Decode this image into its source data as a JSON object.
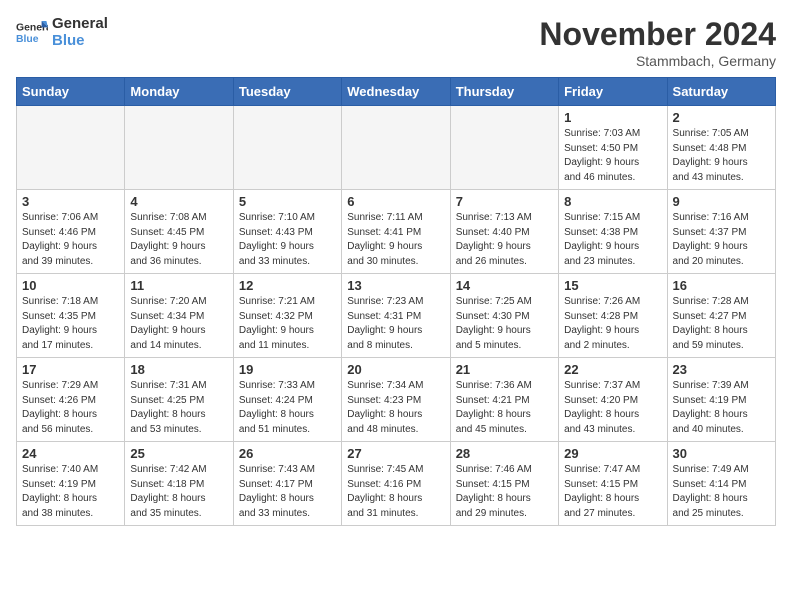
{
  "logo": {
    "line1": "General",
    "line2": "Blue"
  },
  "title": "November 2024",
  "subtitle": "Stammbach, Germany",
  "days_of_week": [
    "Sunday",
    "Monday",
    "Tuesday",
    "Wednesday",
    "Thursday",
    "Friday",
    "Saturday"
  ],
  "weeks": [
    [
      {
        "day": "",
        "info": "",
        "empty": true
      },
      {
        "day": "",
        "info": "",
        "empty": true
      },
      {
        "day": "",
        "info": "",
        "empty": true
      },
      {
        "day": "",
        "info": "",
        "empty": true
      },
      {
        "day": "",
        "info": "",
        "empty": true
      },
      {
        "day": "1",
        "info": "Sunrise: 7:03 AM\nSunset: 4:50 PM\nDaylight: 9 hours\nand 46 minutes."
      },
      {
        "day": "2",
        "info": "Sunrise: 7:05 AM\nSunset: 4:48 PM\nDaylight: 9 hours\nand 43 minutes."
      }
    ],
    [
      {
        "day": "3",
        "info": "Sunrise: 7:06 AM\nSunset: 4:46 PM\nDaylight: 9 hours\nand 39 minutes."
      },
      {
        "day": "4",
        "info": "Sunrise: 7:08 AM\nSunset: 4:45 PM\nDaylight: 9 hours\nand 36 minutes."
      },
      {
        "day": "5",
        "info": "Sunrise: 7:10 AM\nSunset: 4:43 PM\nDaylight: 9 hours\nand 33 minutes."
      },
      {
        "day": "6",
        "info": "Sunrise: 7:11 AM\nSunset: 4:41 PM\nDaylight: 9 hours\nand 30 minutes."
      },
      {
        "day": "7",
        "info": "Sunrise: 7:13 AM\nSunset: 4:40 PM\nDaylight: 9 hours\nand 26 minutes."
      },
      {
        "day": "8",
        "info": "Sunrise: 7:15 AM\nSunset: 4:38 PM\nDaylight: 9 hours\nand 23 minutes."
      },
      {
        "day": "9",
        "info": "Sunrise: 7:16 AM\nSunset: 4:37 PM\nDaylight: 9 hours\nand 20 minutes."
      }
    ],
    [
      {
        "day": "10",
        "info": "Sunrise: 7:18 AM\nSunset: 4:35 PM\nDaylight: 9 hours\nand 17 minutes."
      },
      {
        "day": "11",
        "info": "Sunrise: 7:20 AM\nSunset: 4:34 PM\nDaylight: 9 hours\nand 14 minutes."
      },
      {
        "day": "12",
        "info": "Sunrise: 7:21 AM\nSunset: 4:32 PM\nDaylight: 9 hours\nand 11 minutes."
      },
      {
        "day": "13",
        "info": "Sunrise: 7:23 AM\nSunset: 4:31 PM\nDaylight: 9 hours\nand 8 minutes."
      },
      {
        "day": "14",
        "info": "Sunrise: 7:25 AM\nSunset: 4:30 PM\nDaylight: 9 hours\nand 5 minutes."
      },
      {
        "day": "15",
        "info": "Sunrise: 7:26 AM\nSunset: 4:28 PM\nDaylight: 9 hours\nand 2 minutes."
      },
      {
        "day": "16",
        "info": "Sunrise: 7:28 AM\nSunset: 4:27 PM\nDaylight: 8 hours\nand 59 minutes."
      }
    ],
    [
      {
        "day": "17",
        "info": "Sunrise: 7:29 AM\nSunset: 4:26 PM\nDaylight: 8 hours\nand 56 minutes."
      },
      {
        "day": "18",
        "info": "Sunrise: 7:31 AM\nSunset: 4:25 PM\nDaylight: 8 hours\nand 53 minutes."
      },
      {
        "day": "19",
        "info": "Sunrise: 7:33 AM\nSunset: 4:24 PM\nDaylight: 8 hours\nand 51 minutes."
      },
      {
        "day": "20",
        "info": "Sunrise: 7:34 AM\nSunset: 4:23 PM\nDaylight: 8 hours\nand 48 minutes."
      },
      {
        "day": "21",
        "info": "Sunrise: 7:36 AM\nSunset: 4:21 PM\nDaylight: 8 hours\nand 45 minutes."
      },
      {
        "day": "22",
        "info": "Sunrise: 7:37 AM\nSunset: 4:20 PM\nDaylight: 8 hours\nand 43 minutes."
      },
      {
        "day": "23",
        "info": "Sunrise: 7:39 AM\nSunset: 4:19 PM\nDaylight: 8 hours\nand 40 minutes."
      }
    ],
    [
      {
        "day": "24",
        "info": "Sunrise: 7:40 AM\nSunset: 4:19 PM\nDaylight: 8 hours\nand 38 minutes."
      },
      {
        "day": "25",
        "info": "Sunrise: 7:42 AM\nSunset: 4:18 PM\nDaylight: 8 hours\nand 35 minutes."
      },
      {
        "day": "26",
        "info": "Sunrise: 7:43 AM\nSunset: 4:17 PM\nDaylight: 8 hours\nand 33 minutes."
      },
      {
        "day": "27",
        "info": "Sunrise: 7:45 AM\nSunset: 4:16 PM\nDaylight: 8 hours\nand 31 minutes."
      },
      {
        "day": "28",
        "info": "Sunrise: 7:46 AM\nSunset: 4:15 PM\nDaylight: 8 hours\nand 29 minutes."
      },
      {
        "day": "29",
        "info": "Sunrise: 7:47 AM\nSunset: 4:15 PM\nDaylight: 8 hours\nand 27 minutes."
      },
      {
        "day": "30",
        "info": "Sunrise: 7:49 AM\nSunset: 4:14 PM\nDaylight: 8 hours\nand 25 minutes."
      }
    ]
  ]
}
